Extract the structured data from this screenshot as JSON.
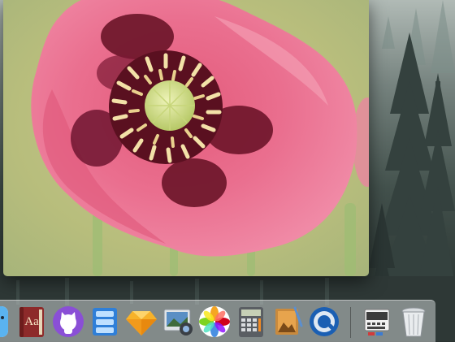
{
  "desktop": {
    "wallpaper_icon": "forest-wallpaper"
  },
  "photo_window": {
    "subject": "pink-poppy-photo"
  },
  "dock": {
    "items": [
      {
        "name": "finder-partial",
        "icon": "finder-icon"
      },
      {
        "name": "dictionary",
        "icon": "dictionary-icon",
        "label": "Aa"
      },
      {
        "name": "github-desktop",
        "icon": "octocat-icon"
      },
      {
        "name": "mail-stickies",
        "icon": "stacked-cards-icon"
      },
      {
        "name": "sketch",
        "icon": "diamond-icon"
      },
      {
        "name": "image-capture",
        "icon": "photo-stack-icon"
      },
      {
        "name": "photos",
        "icon": "pinwheel-icon"
      },
      {
        "name": "calculator",
        "icon": "calculator-icon"
      },
      {
        "name": "preview",
        "icon": "preview-icon"
      },
      {
        "name": "quicktime",
        "icon": "quicktime-icon"
      },
      {
        "name": "downloads-stack",
        "icon": "keyboard-stack-icon"
      },
      {
        "name": "trash",
        "icon": "trash-icon"
      }
    ]
  }
}
